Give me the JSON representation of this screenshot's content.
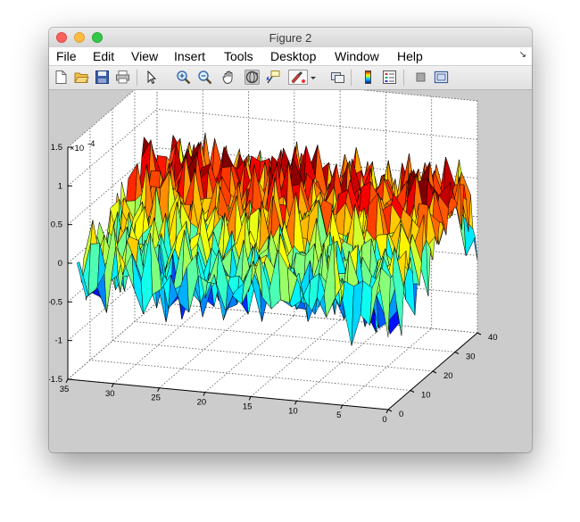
{
  "window": {
    "title": "Figure 2"
  },
  "menubar": {
    "items": [
      "File",
      "Edit",
      "View",
      "Insert",
      "Tools",
      "Desktop",
      "Window",
      "Help"
    ]
  },
  "toolbar": {
    "buttons": [
      "new-figure-icon",
      "open-file-icon",
      "save-icon",
      "print-icon",
      "pointer-icon",
      "zoom-in-icon",
      "zoom-out-icon",
      "pan-icon",
      "rotate-3d-icon",
      "data-cursor-icon",
      "brush-icon",
      "link-plot-icon",
      "insert-colorbar-icon",
      "insert-legend-icon",
      "hide-plot-tools-icon",
      "show-plot-tools-icon"
    ],
    "pressed": "rotate-3d-icon"
  },
  "chart_data": {
    "type": "surface",
    "title": "",
    "exponent_label": "x10^-4",
    "z_ticks": [
      "-1.5",
      "-1",
      "-0.5",
      "0",
      "0.5",
      "1",
      "1.5"
    ],
    "zlim": [
      -1.5,
      1.5
    ],
    "x_ticks": [
      "35",
      "30",
      "25",
      "20",
      "15",
      "10",
      "5",
      "0"
    ],
    "xlim": [
      0,
      35
    ],
    "y_ticks": [
      "0",
      "10",
      "20",
      "30",
      "40"
    ],
    "ylim": [
      0,
      40
    ],
    "grid": true,
    "colormap": "jet",
    "colors": {
      "low": "#0000aa",
      "mid": "#00ffff",
      "high": "#aa0000"
    }
  }
}
